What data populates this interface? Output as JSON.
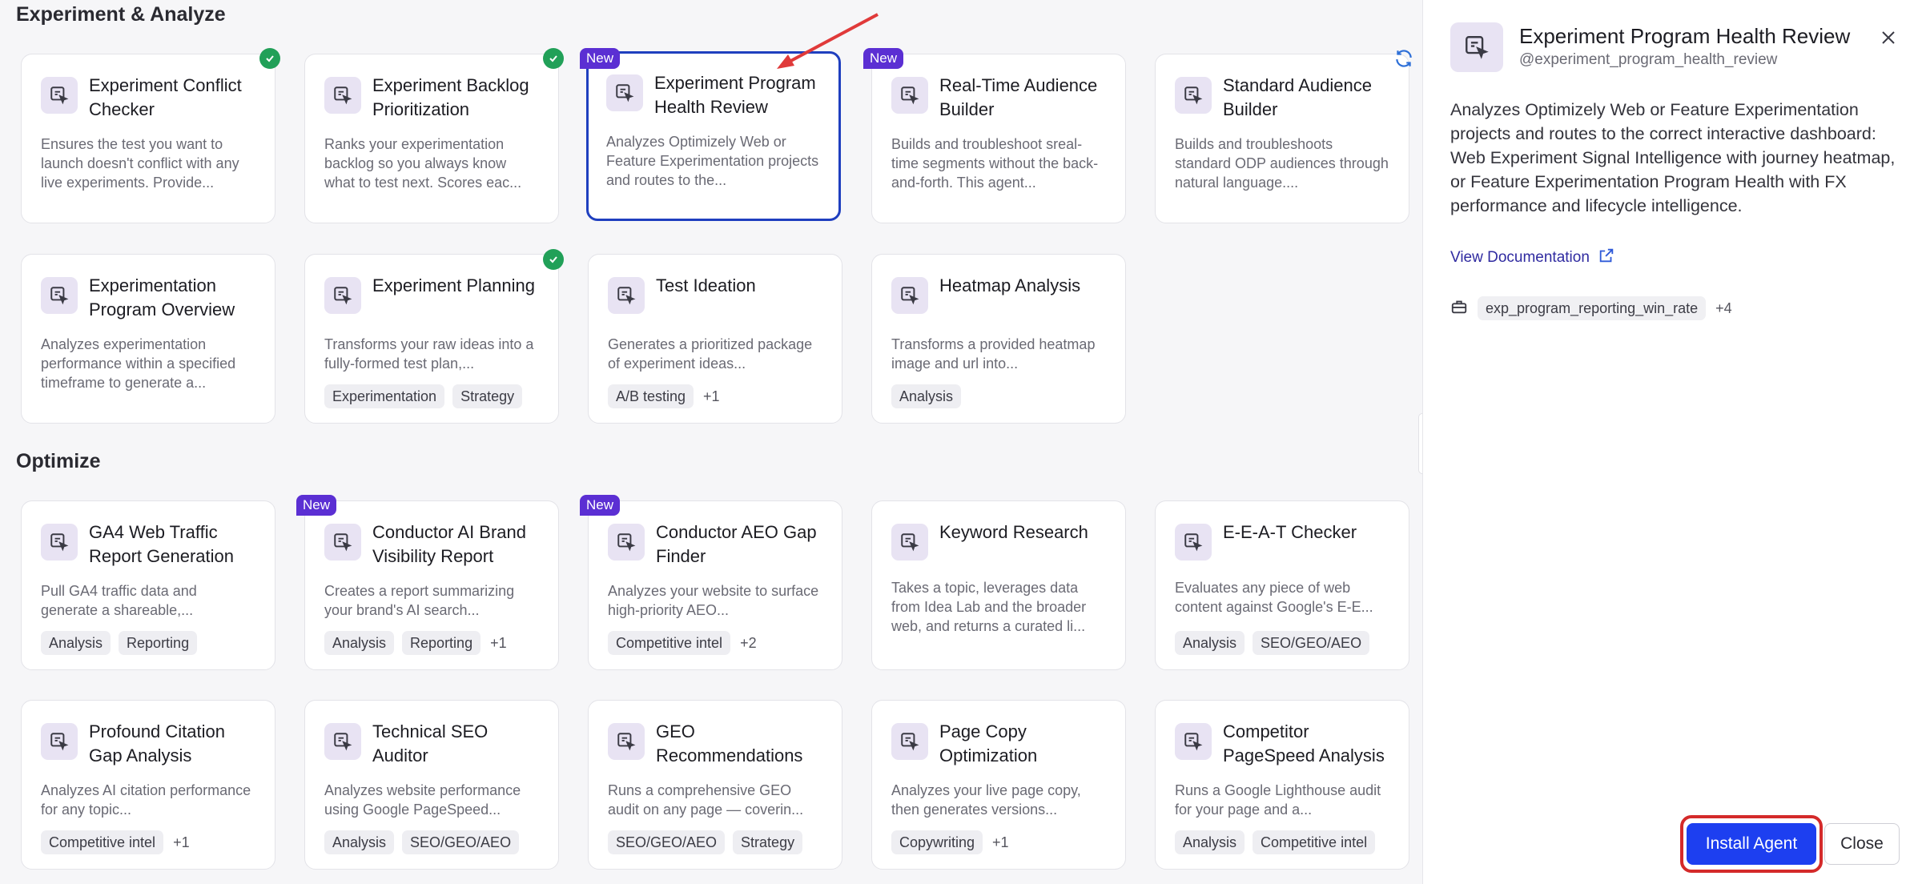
{
  "sections": {
    "experiment": "Experiment & Analyze",
    "optimize": "Optimize"
  },
  "new_label": "New",
  "cards": [
    {
      "title": "Experiment Conflict Checker",
      "desc": "Ensures the test you want to launch doesn't conflict with any live experiments. Provide...",
      "tags": [],
      "more": ""
    },
    {
      "title": "Experiment Backlog Prioritization",
      "desc": "Ranks your experimentation backlog so you always know what to test next. Scores eac...",
      "tags": [],
      "more": ""
    },
    {
      "title": "Experiment Program Health Review",
      "desc": "Analyzes Optimizely Web or Feature Experimentation projects and routes to the...",
      "tags": [],
      "more": ""
    },
    {
      "title": "Real-Time Audience Builder",
      "desc": "Builds and troubleshoot sreal-time segments without the back-and-forth. This agent...",
      "tags": [],
      "more": ""
    },
    {
      "title": "Standard Audience Builder",
      "desc": "Builds and troubleshoots standard ODP audiences through natural language....",
      "tags": [],
      "more": ""
    },
    {
      "title": "Experimentation Program Overview",
      "desc": "Analyzes experimentation performance within a specified timeframe to generate a...",
      "tags": [],
      "more": ""
    },
    {
      "title": "Experiment Planning",
      "desc": "Transforms your raw ideas into a fully-formed test plan,...",
      "tags": [
        "Experimentation",
        "Strategy"
      ],
      "more": ""
    },
    {
      "title": "Test Ideation",
      "desc": "Generates a prioritized package of experiment ideas...",
      "tags": [
        "A/B testing"
      ],
      "more": "+1"
    },
    {
      "title": "Heatmap Analysis",
      "desc": "Transforms a provided heatmap image and url into...",
      "tags": [
        "Analysis"
      ],
      "more": ""
    },
    {
      "title": "GA4 Web Traffic Report Generation",
      "desc": "Pull GA4 traffic data and generate a shareable,...",
      "tags": [
        "Analysis",
        "Reporting"
      ],
      "more": ""
    },
    {
      "title": "Conductor AI Brand Visibility Report",
      "desc": "Creates a report summarizing your brand's AI search...",
      "tags": [
        "Analysis",
        "Reporting"
      ],
      "more": "+1"
    },
    {
      "title": "Conductor AEO Gap Finder",
      "desc": "Analyzes your website to surface high-priority AEO...",
      "tags": [
        "Competitive intel"
      ],
      "more": "+2"
    },
    {
      "title": "Keyword Research",
      "desc": "Takes a topic, leverages data from Idea Lab and the broader web, and returns a curated li...",
      "tags": [],
      "more": ""
    },
    {
      "title": "E-E-A-T Checker",
      "desc": "Evaluates any piece of web content against Google's E-E...",
      "tags": [
        "Analysis",
        "SEO/GEO/AEO"
      ],
      "more": ""
    },
    {
      "title": "Profound Citation Gap Analysis",
      "desc": "Analyzes AI citation performance for any topic...",
      "tags": [
        "Competitive intel"
      ],
      "more": "+1"
    },
    {
      "title": "Technical SEO Auditor",
      "desc": "Analyzes website performance using Google PageSpeed...",
      "tags": [
        "Analysis",
        "SEO/GEO/AEO"
      ],
      "more": ""
    },
    {
      "title": "GEO Recommendations",
      "desc": "Runs a comprehensive GEO audit on any page — coverin...",
      "tags": [
        "SEO/GEO/AEO",
        "Strategy"
      ],
      "more": ""
    },
    {
      "title": "Page Copy Optimization",
      "desc": "Analyzes your live page copy, then generates versions...",
      "tags": [
        "Copywriting"
      ],
      "more": "+1"
    },
    {
      "title": "Competitor PageSpeed Analysis",
      "desc": "Runs a Google Lighthouse audit for your page and a...",
      "tags": [
        "Analysis",
        "Competitive intel"
      ],
      "more": ""
    }
  ],
  "panel": {
    "title": "Experiment Program Health Review",
    "handle": "@experiment_program_health_review",
    "description": "Analyzes Optimizely Web or Feature Experimentation projects and routes to the correct interactive dashboard: Web Experiment Signal Intelligence with journey heatmap, or Feature Experimentation Program Health with FX performance and lifecycle intelligence.",
    "doc_link": "View Documentation",
    "tool": "exp_program_reporting_win_rate",
    "tool_more": "+4",
    "install": "Install Agent",
    "close": "Close"
  },
  "colors": {
    "accent": "#1d3ff0",
    "new_badge": "#5b2fd3",
    "check": "#21a058",
    "highlight": "#d42a2a"
  }
}
